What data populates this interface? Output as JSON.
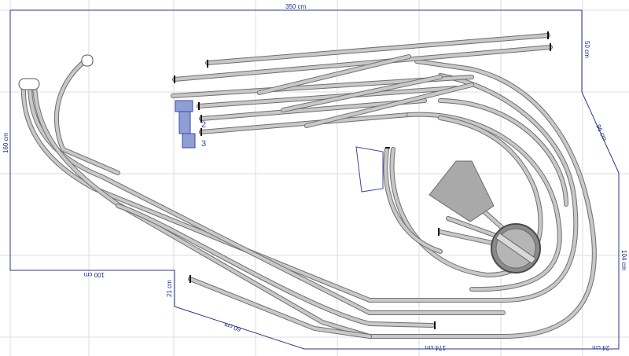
{
  "diagram": {
    "dimensions": {
      "top_width": "350 cm",
      "left_height": "160 cm",
      "bottom_left_width": "100 cm",
      "right_upper_height": "50 cm",
      "right_diagonal": "96 cm",
      "right_lower_height": "104 cm",
      "left_drop_height": "21 cm",
      "bottom_diagonal": "60 cm",
      "bottom_middle_width": "174 cm",
      "bottom_right_width": "24 cm"
    },
    "labels": {
      "marker_2": "2",
      "marker_3": "3"
    }
  },
  "colors": {
    "outline": "#2b3590",
    "track": "#c8c8c8",
    "blue_object": "#8f9fd4",
    "grid": "#dedede"
  }
}
